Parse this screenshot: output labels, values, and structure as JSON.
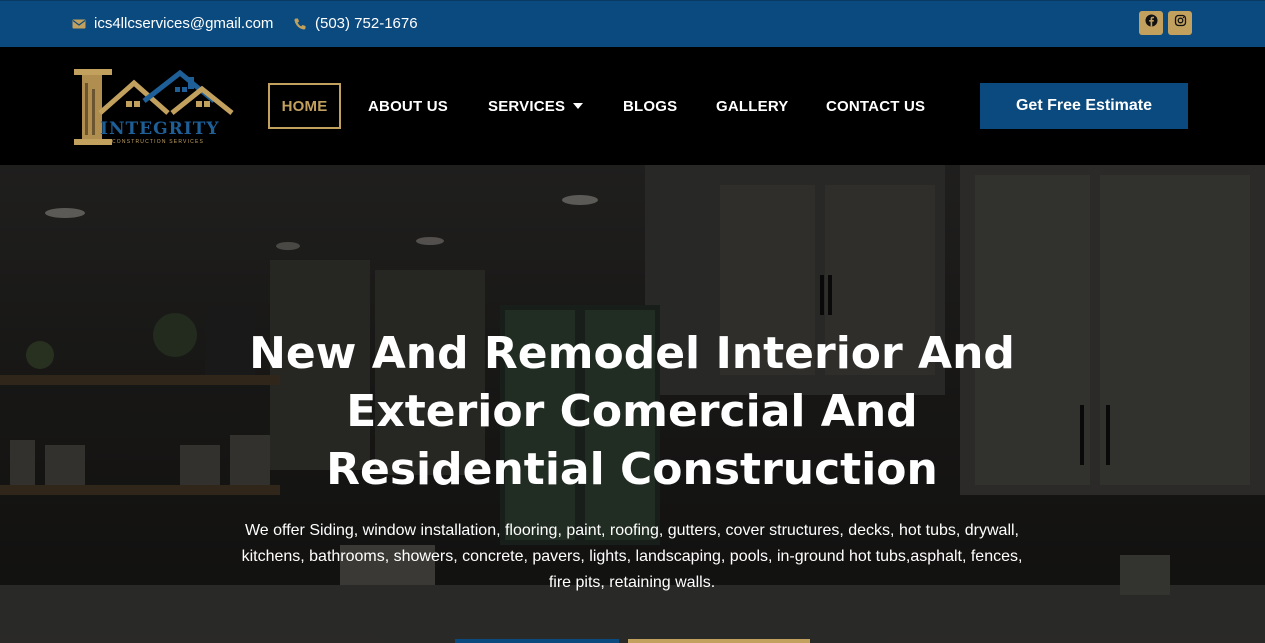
{
  "topbar": {
    "email": "ics4llcservices@gmail.com",
    "phone": "(503) 752-1676",
    "icons": [
      "envelope-icon",
      "phone-icon",
      "facebook-icon",
      "instagram-icon"
    ]
  },
  "header": {
    "logo_text": "INTEGRITY",
    "logo_subtext": "CONSTRUCTION SERVICES",
    "nav": [
      {
        "label": "HOME",
        "active": true
      },
      {
        "label": "ABOUT US"
      },
      {
        "label": "SERVICES",
        "has_dropdown": true
      },
      {
        "label": "BLOGS"
      },
      {
        "label": "GALLERY"
      },
      {
        "label": "CONTACT US"
      }
    ],
    "cta_label": "Get Free Estimate"
  },
  "hero": {
    "title": "New And Remodel Interior And Exterior Comercial And Residential Construction",
    "description": "We offer Siding, window installation, flooring, paint, roofing, gutters, cover structures, decks, hot tubs, drywall, kitchens, bathrooms, showers, concrete, pavers, lights, landscaping, pools, in-ground hot tubs,asphalt, fences, fire pits, retaining walls."
  },
  "colors": {
    "brand_blue": "#0b4a7e",
    "brand_gold": "#c2a15f",
    "header_bg": "#000000"
  }
}
